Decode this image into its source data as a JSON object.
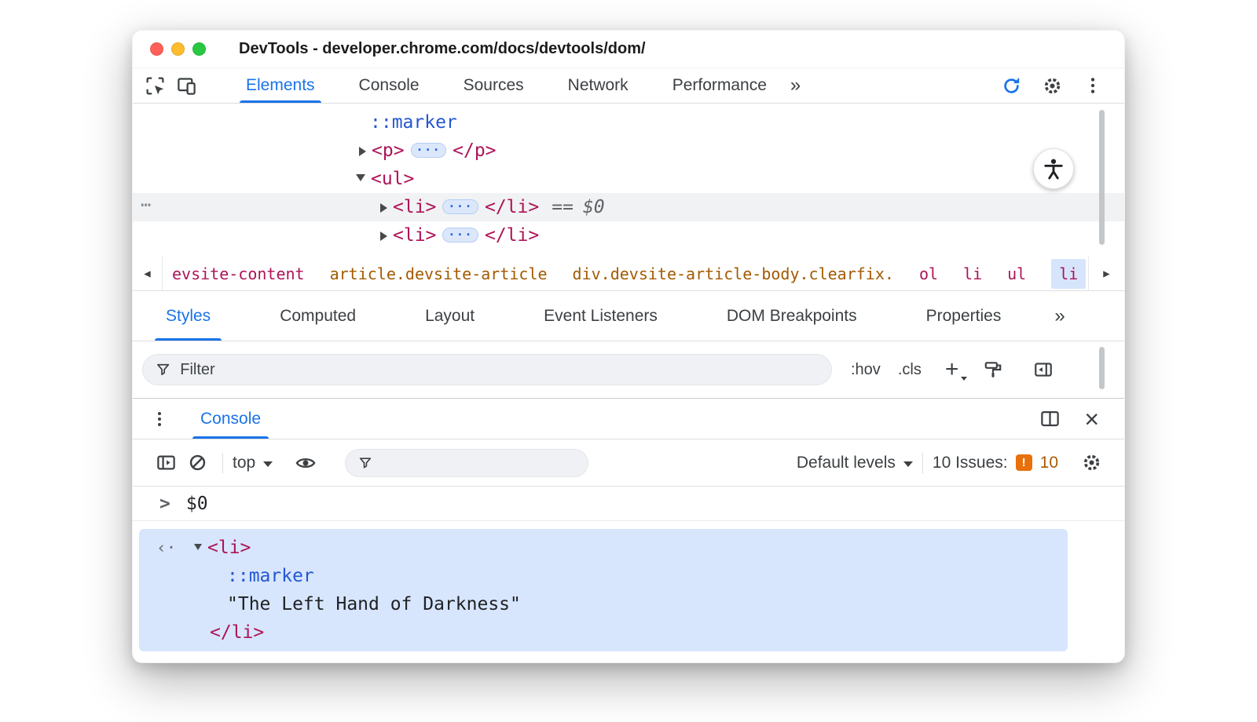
{
  "window": {
    "title": "DevTools - developer.chrome.com/docs/devtools/dom/"
  },
  "main_tabs": {
    "items": [
      {
        "label": "Elements",
        "active": true
      },
      {
        "label": "Console"
      },
      {
        "label": "Sources"
      },
      {
        "label": "Network"
      },
      {
        "label": "Performance"
      }
    ]
  },
  "icons": {
    "more_tabs": "»",
    "ellipsis": "···",
    "gutter_dots": "⋯",
    "crumb_left": "◀",
    "crumb_right": "▶",
    "close": "×",
    "prompt_chevron": ">",
    "result_arrow": "‹·",
    "issues_badge": "!",
    "new_rule_plus": "+"
  },
  "elements_tree": {
    "marker_row": {
      "pseudo": "::marker"
    },
    "p_row": {
      "open": "<p>",
      "close": "</p>"
    },
    "ul_row": {
      "open": "<ul>"
    },
    "li_selected_row": {
      "open": "<li>",
      "close": "</li>",
      "equals": "==",
      "variable": "$0"
    },
    "li_row": {
      "open": "<li>",
      "close": "</li>"
    }
  },
  "breadcrumbs": {
    "items": [
      {
        "label": "evsite-content"
      },
      {
        "label": "article.devsite-article"
      },
      {
        "label": "div.devsite-article-body.clearfix."
      },
      {
        "label": "ol"
      },
      {
        "label": "li"
      },
      {
        "label": "ul"
      },
      {
        "label": "li",
        "selected": true
      }
    ]
  },
  "styles_tabs": {
    "items": [
      {
        "label": "Styles",
        "active": true
      },
      {
        "label": "Computed"
      },
      {
        "label": "Layout"
      },
      {
        "label": "Event Listeners"
      },
      {
        "label": "DOM Breakpoints"
      },
      {
        "label": "Properties"
      }
    ]
  },
  "styles_toolbar": {
    "filter_placeholder": "Filter",
    "pseudo_state_toggle": ":hov",
    "class_toggle": ".cls"
  },
  "console": {
    "tab_label": "Console",
    "context_selector": "top",
    "levels_selector": "Default levels",
    "issues_label": "10 Issues:",
    "issues_count": "10",
    "expression": "$0",
    "result": {
      "open_tag": "<li>",
      "pseudo": "::marker",
      "string_value": "\"The Left Hand of Darkness\"",
      "close_tag": "</li>"
    }
  },
  "colors": {
    "accent_blue": "#1a73e8",
    "code_tag_crimson": "#ad1457",
    "code_pseudo_blue": "#2456d3",
    "breadcrumb_class_orange": "#a35a00",
    "selection_blue": "#d7e6fd",
    "issues_orange": "#e8710a"
  }
}
